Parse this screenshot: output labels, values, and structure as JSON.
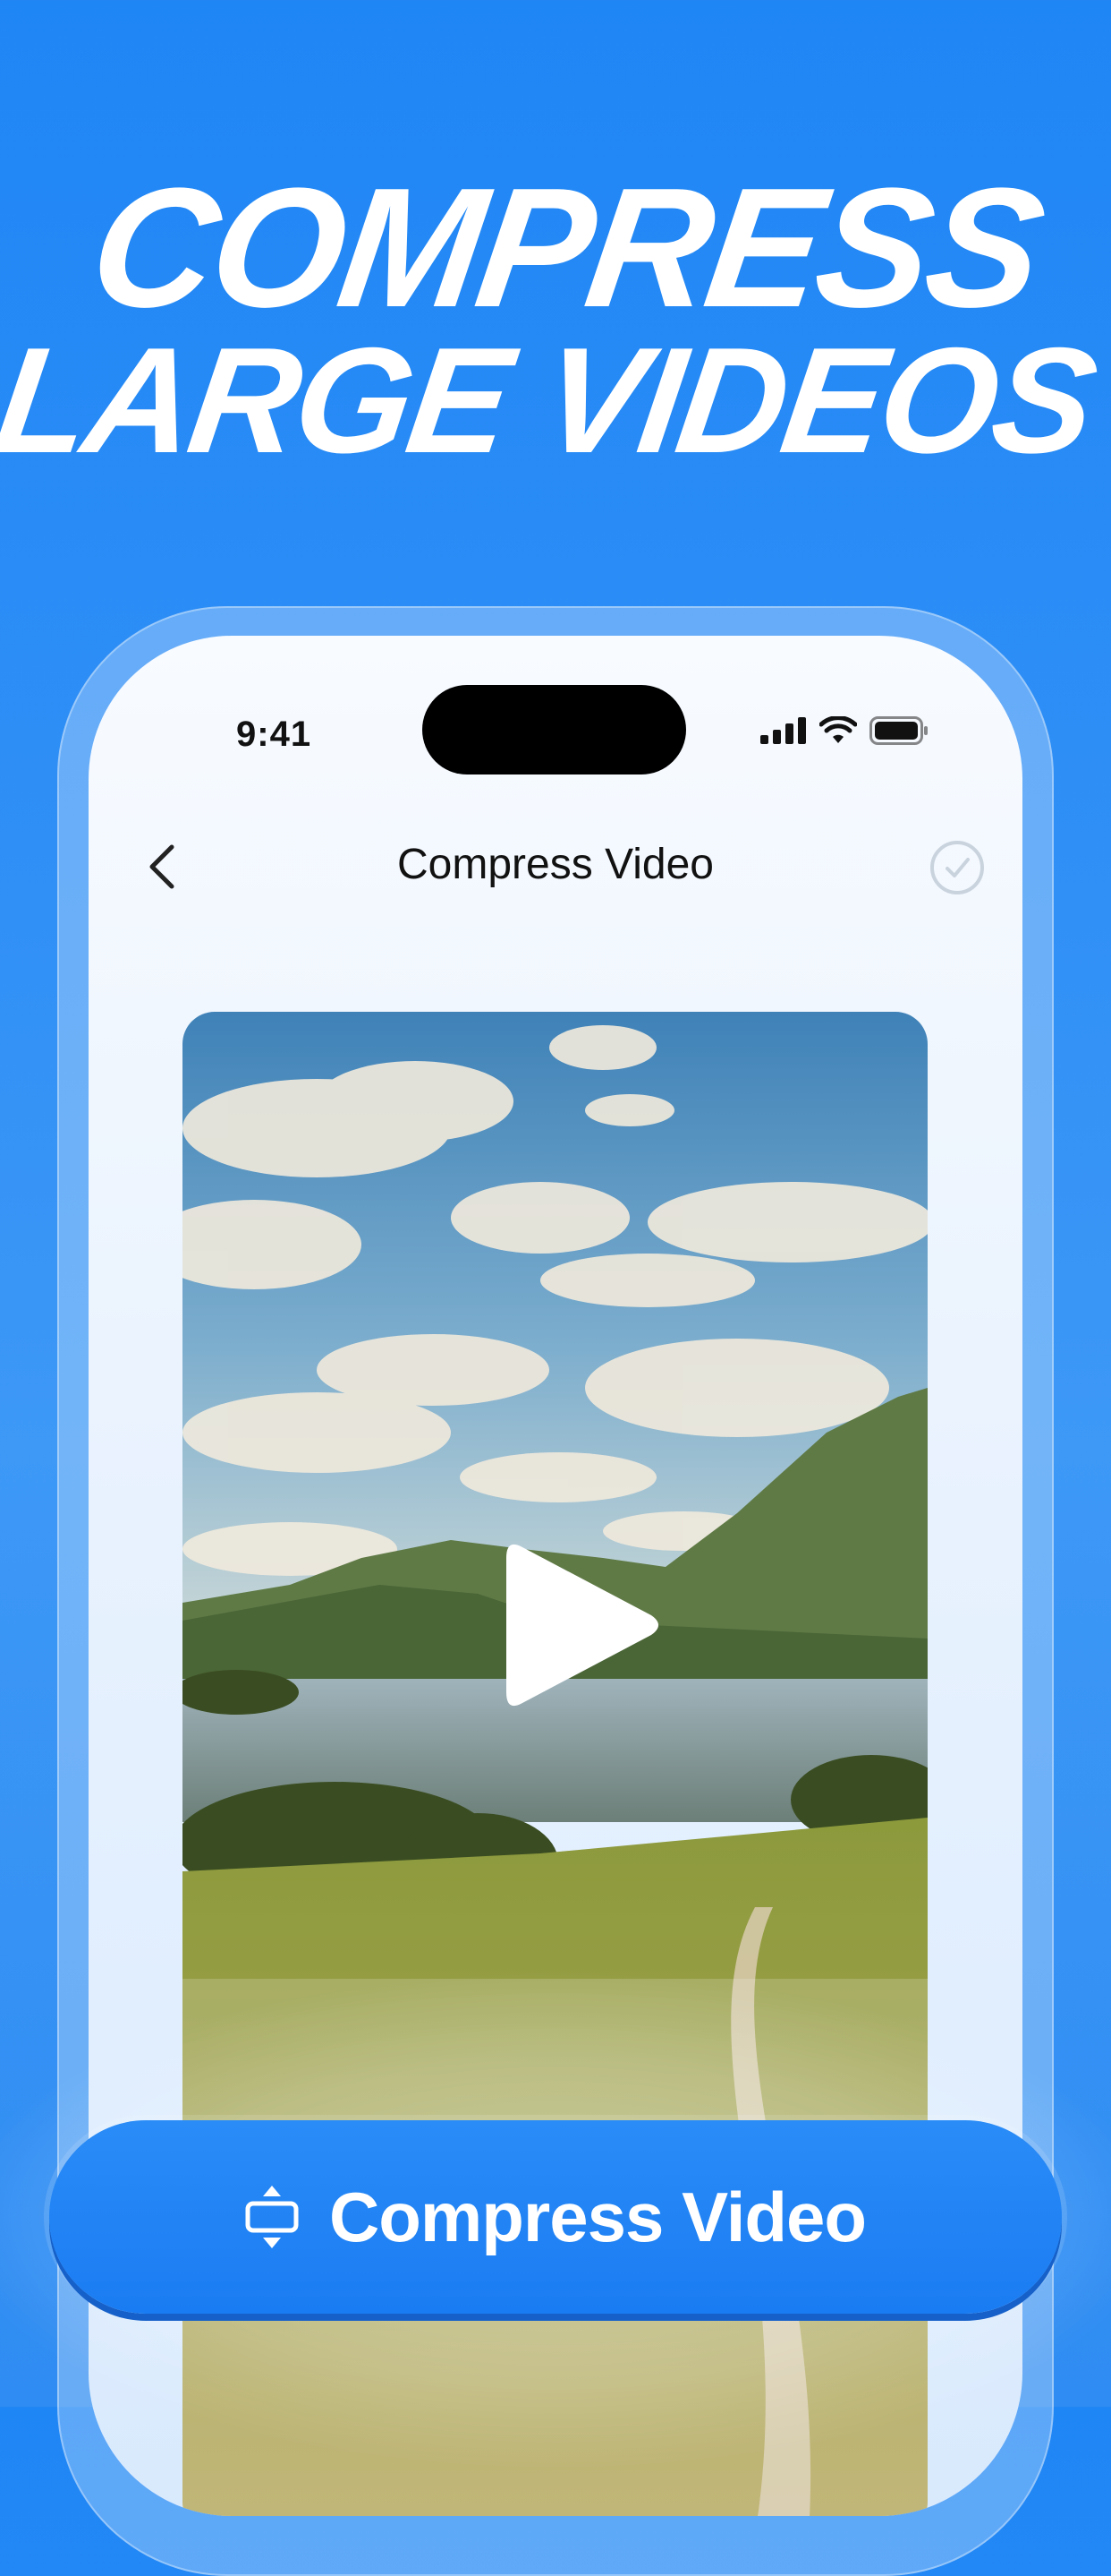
{
  "headline": {
    "line1": "COMPRESS",
    "line2": "LARGE VIDEOS"
  },
  "status_bar": {
    "time": "9:41",
    "icons": [
      "signal-icon",
      "wifi-icon",
      "battery-icon"
    ]
  },
  "nav": {
    "title": "Compress Video",
    "back_icon": "chevron-left-icon",
    "confirm_icon": "checkmark-circle-icon"
  },
  "video": {
    "thumbnail": "landscape-lake-mountains",
    "play_icon": "play-icon"
  },
  "cta": {
    "label": "Compress Video",
    "icon": "compress-icon"
  },
  "colors": {
    "background": "#1f86f5",
    "button": "#1a7cf2",
    "text_on_accent": "#ffffff"
  }
}
